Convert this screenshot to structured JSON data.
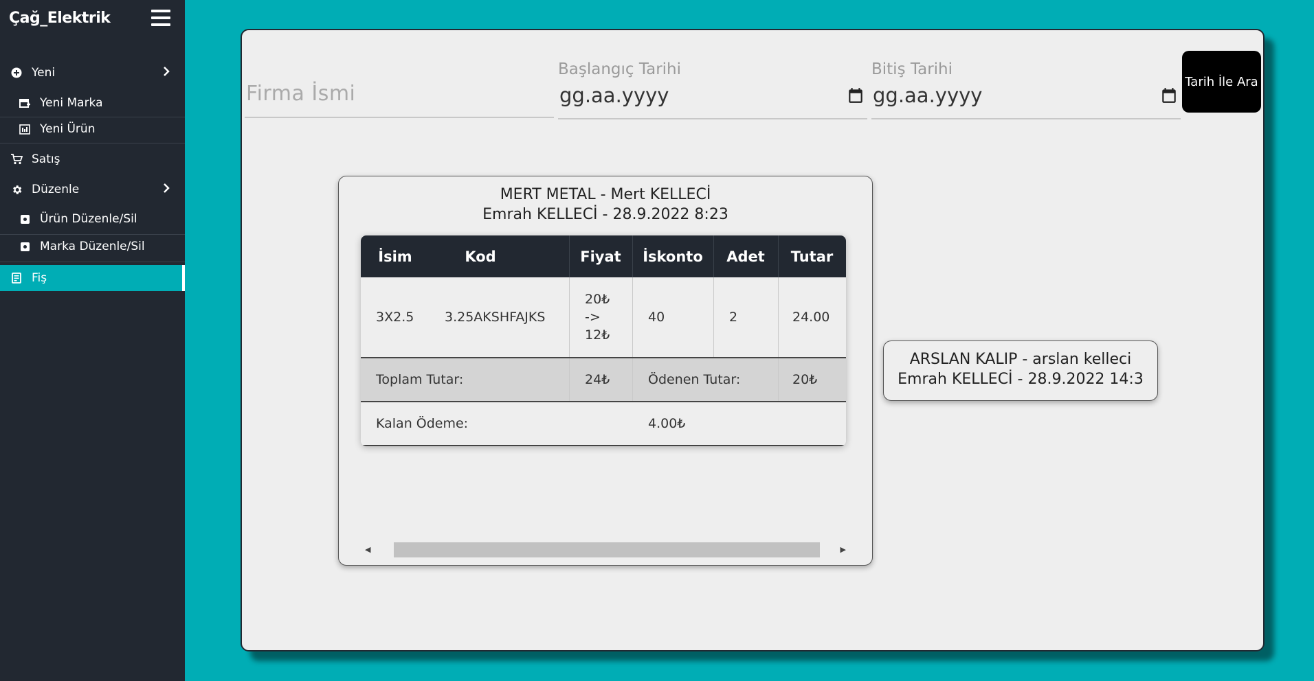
{
  "sidebar": {
    "brand": "Çağ_Elektrik",
    "items": [
      {
        "label": "Yeni"
      },
      {
        "label": "Yeni Marka"
      },
      {
        "label": "Yeni Ürün"
      },
      {
        "label": "Satış"
      },
      {
        "label": "Düzenle"
      },
      {
        "label": "Ürün Düzenle/Sil"
      },
      {
        "label": "Marka Düzenle/Sil"
      },
      {
        "label": "Fiş"
      }
    ]
  },
  "filters": {
    "firma_placeholder": "Firma İsmi",
    "start_label": "Başlangıç Tarihi",
    "start_value": "gg.aa.yyyy",
    "end_label": "Bitiş Tarihi",
    "end_value": "gg.aa.yyyy",
    "search_button": "Tarih İle Ara"
  },
  "receipts": [
    {
      "title": "MERT METAL - Mert KELLECİ",
      "subtitle": "Emrah KELLECİ - 28.9.2022 8:23",
      "columns": [
        "İsim",
        "Kod",
        "Fiyat",
        "İskonto",
        "Adet",
        "Tutar"
      ],
      "rows": [
        {
          "isim": "3X2.5",
          "kod": "3.25AKSHFAJKS",
          "fiyat_1": "20₺",
          "fiyat_2": "->",
          "fiyat_3": "12₺",
          "iskonto": "40",
          "adet": "2",
          "tutar": "24.00"
        }
      ],
      "total_label": "Toplam Tutar:",
      "total_value": "24₺",
      "paid_label": "Ödenen Tutar:",
      "paid_value": "20₺",
      "remaining_label": "Kalan Ödeme:",
      "remaining_value": "4.00₺"
    },
    {
      "title": "ARSLAN KALIP - arslan kelleci",
      "subtitle": "Emrah KELLECİ - 28.9.2022 14:3"
    }
  ],
  "colors": {
    "accent": "#00adb5",
    "dark": "#222831",
    "panel": "#eeeeee"
  }
}
